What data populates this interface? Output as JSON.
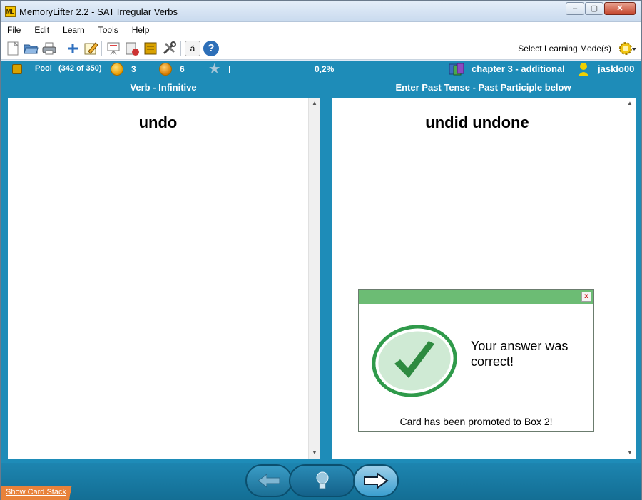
{
  "window": {
    "title": "MemoryLifter 2.2 - SAT Irregular Verbs",
    "app_icon_text": "ML"
  },
  "menu": [
    "File",
    "Edit",
    "Learn",
    "Tools",
    "Help"
  ],
  "toolbar": {
    "icons": [
      "new-file-icon",
      "open-folder-icon",
      "print-icon",
      "add-card-icon",
      "edit-card-icon",
      "presentation-icon",
      "statistics-icon",
      "card-box-icon",
      "tools-icon",
      "special-character-icon",
      "help-icon"
    ],
    "special_char": "á",
    "help_char": "?",
    "mode_label": "Select Learning Mode(s)"
  },
  "status": {
    "pool_label": "Pool",
    "pool_count": "(342 of 350)",
    "happy_count": "3",
    "sad_count": "6",
    "progress_fraction": 0.002,
    "progress_text": "0,2%",
    "chapter": "chapter 3 - additional",
    "user": "jasklo00"
  },
  "left_pane": {
    "title": "Verb - Infinitive",
    "word": "undo"
  },
  "right_pane": {
    "title": "Enter Past Tense - Past Participle below",
    "word": "undid undone"
  },
  "popup": {
    "close": "x",
    "message": "Your answer was correct!",
    "note": "Card has been promoted to Box 2!"
  },
  "bottom": {
    "stack_link": "Show Card Stack"
  },
  "colors": {
    "accent": "#1e8cb8",
    "popup_header": "#6cbc74",
    "stack_tab": "#e8823a"
  }
}
